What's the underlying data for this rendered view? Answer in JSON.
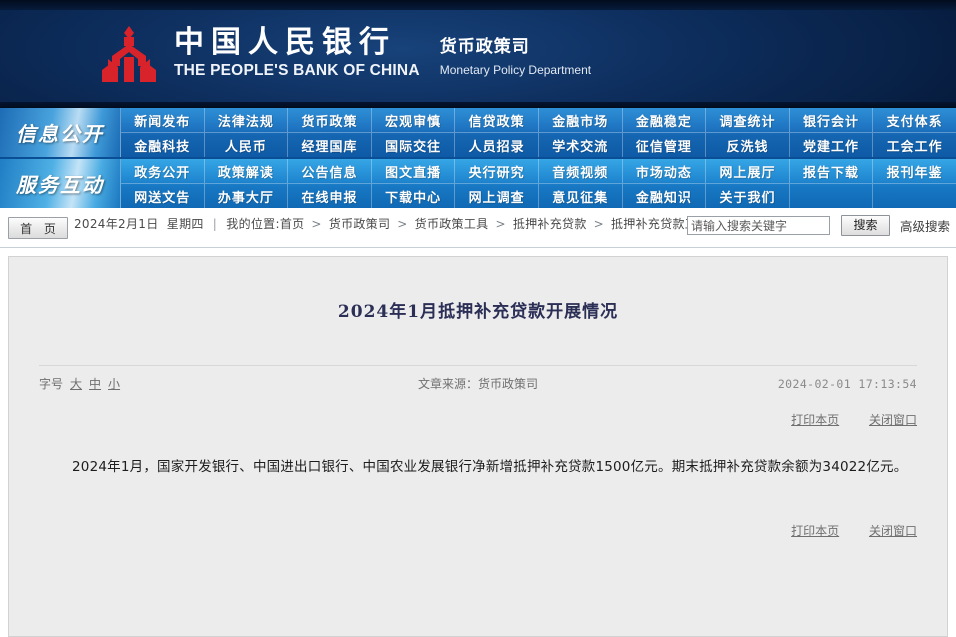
{
  "banner": {
    "logo_icon": "pbc-logo-icon",
    "bank_name_cn": "中国人民银行",
    "bank_name_en": "THE PEOPLE'S BANK OF CHINA",
    "department_cn": "货币政策司",
    "department_en": "Monetary Policy Department"
  },
  "nav": {
    "groups": [
      {
        "label": "信息公开",
        "row_top": [
          "新闻发布",
          "法律法规",
          "货币政策",
          "宏观审慎",
          "信贷政策",
          "金融市场",
          "金融稳定",
          "调查统计",
          "银行会计",
          "支付体系"
        ],
        "row_bottom": [
          "金融科技",
          "人民币",
          "经理国库",
          "国际交往",
          "人员招录",
          "学术交流",
          "征信管理",
          "反洗钱",
          "党建工作",
          "工会工作"
        ]
      },
      {
        "label": "服务互动",
        "row_top": [
          "政务公开",
          "政策解读",
          "公告信息",
          "图文直播",
          "央行研究",
          "音频视频",
          "市场动态",
          "网上展厅",
          "报告下载",
          "报刊年鉴"
        ],
        "row_bottom": [
          "网送文告",
          "办事大厅",
          "在线申报",
          "下载中心",
          "网上调查",
          "意见征集",
          "金融知识",
          "关于我们"
        ]
      }
    ]
  },
  "crumbbar": {
    "home_button": "首 页",
    "date": "2024年2月1日",
    "weekday": "星期四",
    "separator": "|",
    "location_label": "我的位置:",
    "path": [
      "首页",
      "货币政策司",
      "货币政策工具",
      "抵押补充贷款",
      "抵押补充贷款工作信息"
    ],
    "arrow": ">"
  },
  "search": {
    "placeholder": "请输入搜索关键字",
    "value": "",
    "button_label": "搜索",
    "advanced_label": "高级搜索"
  },
  "article": {
    "title": "2024年1月抵押补充贷款开展情况",
    "fontsize_label": "字号",
    "fontsize_options": [
      "大",
      "中",
      "小"
    ],
    "source": "文章来源：货币政策司",
    "timestamp": "2024-02-01 17:13:54",
    "print_label": "打印本页",
    "close_label": "关闭窗口",
    "body": "2024年1月，国家开发银行、中国进出口银行、中国农业发展银行净新增抵押补充贷款1500亿元。期末抵押补充贷款余额为34022亿元。"
  },
  "colors": {
    "banner_dark": "#04152f",
    "nav_blue": "#1878c4",
    "logo_red": "#d8232a",
    "panel_gray": "#ececec",
    "title_color": "#2b2f56"
  }
}
